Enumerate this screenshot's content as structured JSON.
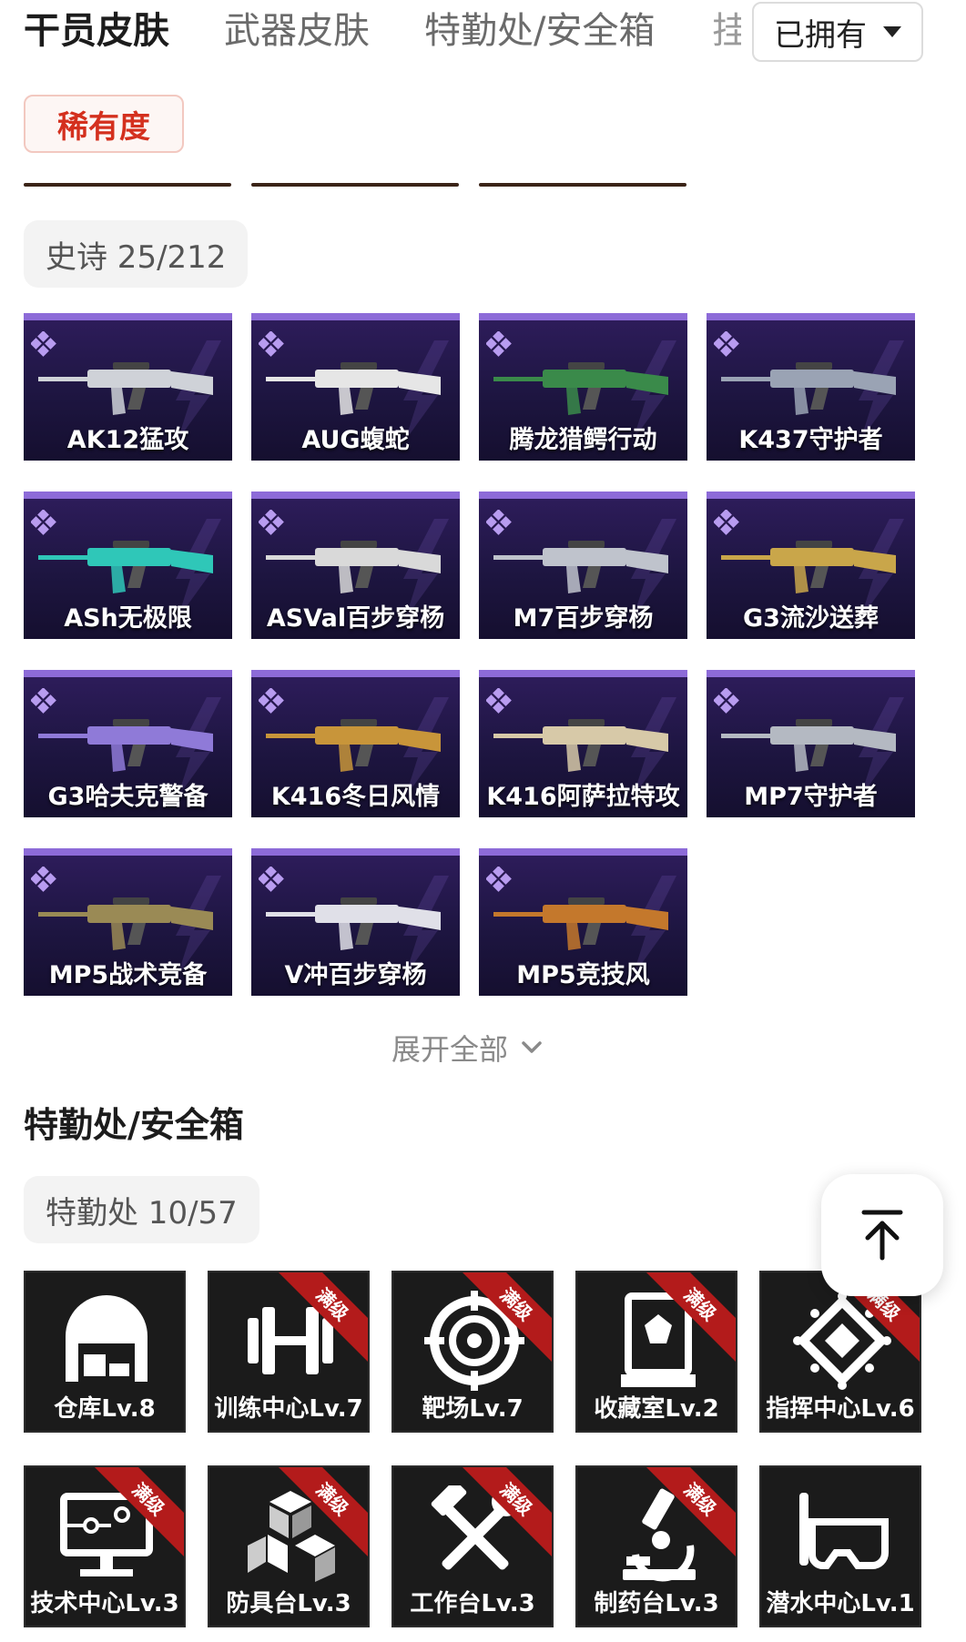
{
  "tabs": [
    {
      "label": "干员皮肤",
      "active": true
    },
    {
      "label": "武器皮肤",
      "active": false
    },
    {
      "label": "特勤处/安全箱",
      "active": false
    },
    {
      "label": "挂",
      "active": false
    }
  ],
  "owned_filter": {
    "label": "已拥有",
    "icon": "caret-down-icon"
  },
  "rarity_filter": {
    "label": "稀有度",
    "color": "#d4301e"
  },
  "epic_group": {
    "label": "史诗 25/212",
    "accent": "#8d6bd8"
  },
  "weapons": [
    {
      "name": "AK12猛攻"
    },
    {
      "name": "AUG蝮蛇"
    },
    {
      "name": "腾龙猎鳄行动"
    },
    {
      "name": "K437守护者"
    },
    {
      "name": "ASh无极限"
    },
    {
      "name": "ASVal百步穿杨"
    },
    {
      "name": "M7百步穿杨"
    },
    {
      "name": "G3流沙送葬"
    },
    {
      "name": "G3哈夫克警备"
    },
    {
      "name": "K416冬日风情"
    },
    {
      "name": "K416阿萨拉特攻"
    },
    {
      "name": "MP7守护者"
    },
    {
      "name": "MP5战术竞备"
    },
    {
      "name": "V冲百步穿杨"
    },
    {
      "name": "MP5竞技风"
    }
  ],
  "expand": {
    "label": "展开全部",
    "icon": "chevron-down-icon"
  },
  "section2": {
    "title": "特勤处/安全箱"
  },
  "facility_group": {
    "label": "特勤处 10/57"
  },
  "max_badge": "满级",
  "facilities": [
    {
      "name": "仓库Lv.8",
      "icon": "warehouse-icon",
      "max": false
    },
    {
      "name": "训练中心Lv.7",
      "icon": "dumbbell-icon",
      "max": true
    },
    {
      "name": "靶场Lv.7",
      "icon": "target-icon",
      "max": true
    },
    {
      "name": "收藏室Lv.2",
      "icon": "display-case-icon",
      "max": true
    },
    {
      "name": "指挥中心Lv.6",
      "icon": "chip-icon",
      "max": true
    },
    {
      "name": "技术中心Lv.3",
      "icon": "monitor-icon",
      "max": true
    },
    {
      "name": "防具台Lv.3",
      "icon": "cubes-icon",
      "max": true
    },
    {
      "name": "工作台Lv.3",
      "icon": "tools-icon",
      "max": true
    },
    {
      "name": "制药台Lv.3",
      "icon": "microscope-icon",
      "max": true
    },
    {
      "name": "潜水中心Lv.1",
      "icon": "dive-mask-icon",
      "max": false
    }
  ],
  "back_to_top": {
    "icon": "arrow-up-to-top-icon"
  }
}
